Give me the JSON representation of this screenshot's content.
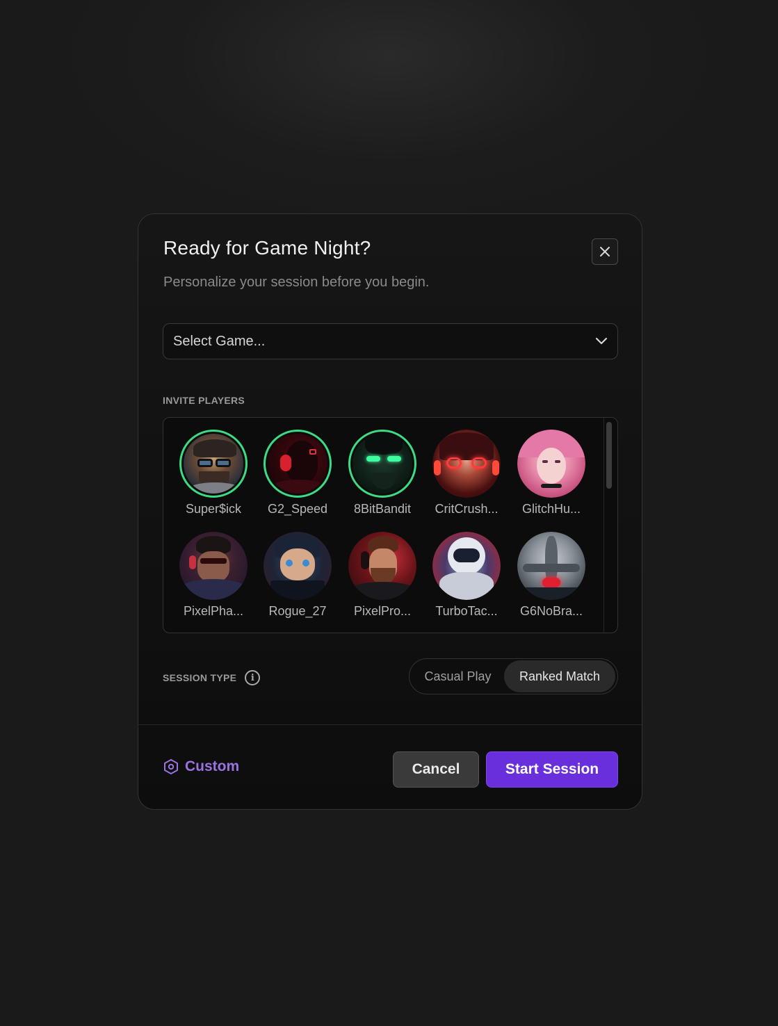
{
  "modal": {
    "title": "Ready for Game Night?",
    "subtitle": "Personalize your session before you begin.",
    "close_icon": "close-icon"
  },
  "game_select": {
    "value": "Select Game...",
    "icon": "chevron-down-icon"
  },
  "invite": {
    "label": "INVITE PLAYERS",
    "players": [
      {
        "name": "Super$ick",
        "selected": true
      },
      {
        "name": "G2_Speed",
        "selected": true
      },
      {
        "name": "8BitBandit",
        "selected": true
      },
      {
        "name": "CritCrush...",
        "selected": false
      },
      {
        "name": "GlitchHu...",
        "selected": false
      },
      {
        "name": "PixelPha...",
        "selected": false
      },
      {
        "name": "Rogue_27",
        "selected": false
      },
      {
        "name": "PixelPro...",
        "selected": false
      },
      {
        "name": "TurboTac...",
        "selected": false
      },
      {
        "name": "G6NoBra...",
        "selected": false
      }
    ]
  },
  "session": {
    "label": "SESSION TYPE",
    "info_icon": "info-icon",
    "options": [
      "Casual Play",
      "Ranked Match"
    ],
    "selected": "Ranked Match"
  },
  "footer": {
    "custom_label": "Custom",
    "custom_icon": "hexagon-gear-icon",
    "cancel_label": "Cancel",
    "start_label": "Start Session"
  },
  "colors": {
    "accent": "#6a2fdc",
    "selected_ring": "#3ddc84",
    "custom_text": "#9b73e0"
  }
}
